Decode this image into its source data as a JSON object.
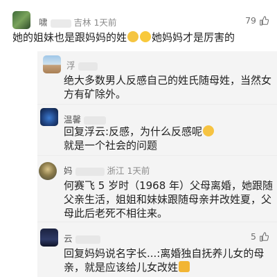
{
  "comments": [
    {
      "user": "啸",
      "user_tail": "吉林",
      "time": "1天前",
      "likes": "79",
      "lines": [
        "她的姐妹也是跟妈妈的姓",
        "她妈妈才是厉害的"
      ]
    },
    {
      "user": "浮",
      "lines": [
        "绝大多数男人反感自己的姓氏随母姓，当然女",
        "方有矿除外。"
      ]
    },
    {
      "user": "温馨",
      "lines": [
        "回复浮云:反感，为什么反感呢",
        "就是一个社会的问题"
      ]
    },
    {
      "user": "妈",
      "user_tail": "浙江",
      "time": "1天前",
      "lines": [
        "何赛飞 5 岁时（1968 年）父母离婚，她跟随",
        "父亲生活，姐姐和妹妹跟随母亲并改姓夏，父",
        "母此后老死不相往来。"
      ]
    },
    {
      "user": "云",
      "likes": "5",
      "lines": [
        "回复妈妈说名字长...:离婚独自抚养儿女的母",
        "亲，就是应该给儿女改姓"
      ]
    }
  ],
  "icons": {
    "like": "thumbs-up-icon",
    "emoji_cat": "cat-smile-emoji",
    "emoji_grin": "grin-emoji",
    "emoji_cry": "crying-face-emoji",
    "emoji_thumb": "thumbs-up-emoji"
  }
}
